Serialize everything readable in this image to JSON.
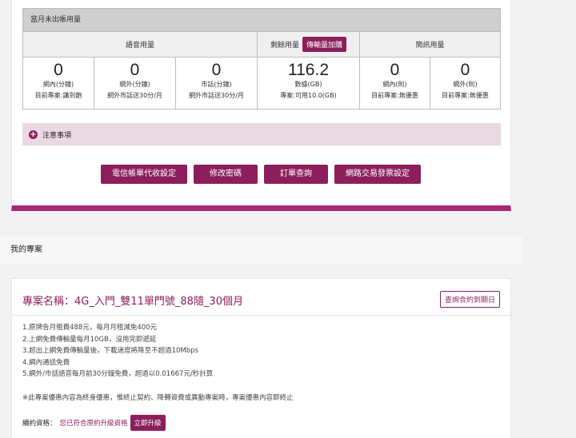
{
  "usage": {
    "header": "當月未出帳用量",
    "groups": {
      "voice": "語音用量",
      "data": "剩餘用量",
      "data_button": "傳輸量加購",
      "sms": "簡訊用量"
    },
    "cells": [
      {
        "value": "0",
        "label": "網內(分鐘)",
        "note": "目前專案:講到飽"
      },
      {
        "value": "0",
        "label": "網外(分鐘)",
        "note": "網外市話送30分/月"
      },
      {
        "value": "0",
        "label": "市話(分鐘)",
        "note": "網外市話送30分/月"
      },
      {
        "value": "116.2",
        "label": "數據(GB)",
        "note": "專案:可用10.0(GB)"
      },
      {
        "value": "0",
        "label": "網內(則)",
        "note": "目前專案:無優惠"
      },
      {
        "value": "0",
        "label": "網外(則)",
        "note": "目前專案:無優惠"
      }
    ]
  },
  "notice": {
    "label": "注意事項"
  },
  "actions": [
    "電信帳單代收設定",
    "修改密碼",
    "訂單查詢",
    "網路交易發票設定"
  ],
  "section": {
    "title": "我的專案"
  },
  "plan": {
    "name": "專案名稱：4G_入門_雙11單門號_88隨_30個月",
    "expiry_button": "查詢合約到期日",
    "features": [
      "1.原牌告月租費488元，每月月租減免400元",
      "2.上網免費傳輸量每月10GB，沒用完即遞延",
      "3.超出上網免費傳輸量後，下載速度將降至不超過10Mbps",
      "4.網內通話免費",
      "5.網外/市話語音每月前30分鐘免費，超過以0.01667元/秒計算"
    ],
    "disclaimer": "※此專案優惠內容為終身優惠，惟終止契約、降轉資費或異動專案時，專案優惠內容即終止",
    "eligibility_label": "續約資格：",
    "eligibility_status": "您已符合原約升級資格",
    "upgrade_button": "立即升級"
  }
}
